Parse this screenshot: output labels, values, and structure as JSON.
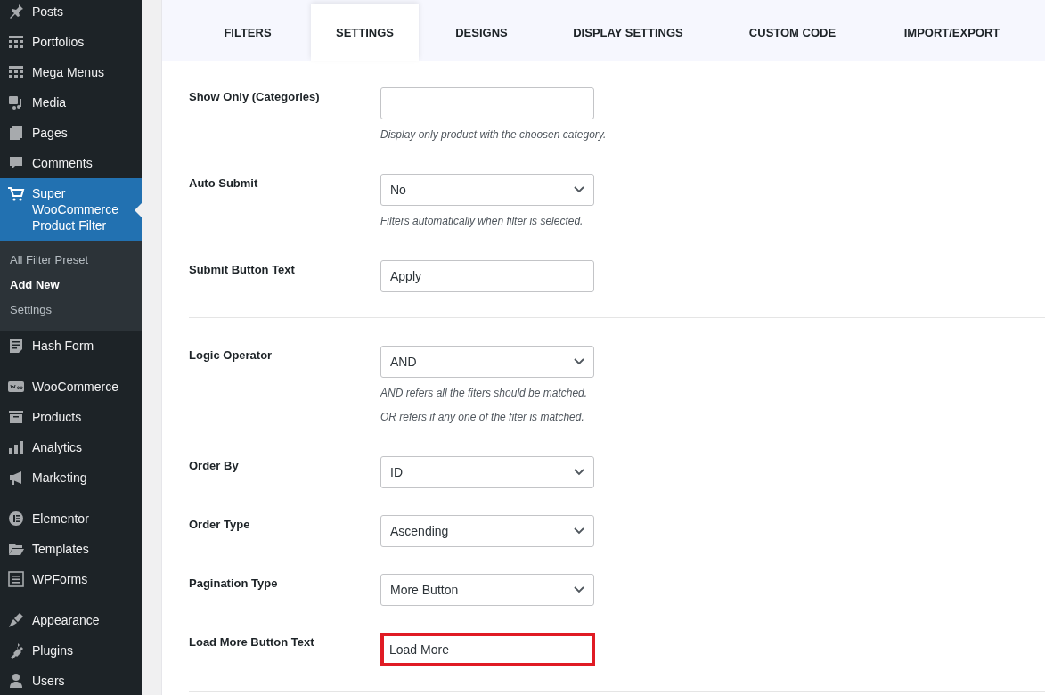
{
  "sidebar": {
    "groups": [
      {
        "items": [
          {
            "label": "Posts",
            "selected": false
          },
          {
            "label": "Portfolios",
            "selected": false
          },
          {
            "label": "Mega Menus",
            "selected": false
          },
          {
            "label": "Media",
            "selected": false
          },
          {
            "label": "Pages",
            "selected": false
          },
          {
            "label": "Comments",
            "selected": false
          },
          {
            "label": "Super WooCommerce Product Filter",
            "selected": true,
            "children": [
              {
                "label": "All Filter Preset",
                "selected": false
              },
              {
                "label": "Add New",
                "selected": true
              },
              {
                "label": "Settings",
                "selected": false
              }
            ]
          },
          {
            "label": "Hash Form",
            "selected": false
          }
        ]
      },
      {
        "items": [
          {
            "label": "WooCommerce",
            "selected": false
          },
          {
            "label": "Products",
            "selected": false
          },
          {
            "label": "Analytics",
            "selected": false
          },
          {
            "label": "Marketing",
            "selected": false
          }
        ]
      },
      {
        "items": [
          {
            "label": "Elementor",
            "selected": false
          },
          {
            "label": "Templates",
            "selected": false
          },
          {
            "label": "WPForms",
            "selected": false
          }
        ]
      },
      {
        "items": [
          {
            "label": "Appearance",
            "selected": false
          },
          {
            "label": "Plugins",
            "selected": false
          },
          {
            "label": "Users",
            "selected": false
          }
        ]
      }
    ]
  },
  "tabs": [
    {
      "label": "FILTERS",
      "selected": false
    },
    {
      "label": "SETTINGS",
      "selected": true
    },
    {
      "label": "DESIGNS",
      "selected": false
    },
    {
      "label": "DISPLAY SETTINGS",
      "selected": false
    },
    {
      "label": "CUSTOM CODE",
      "selected": false
    },
    {
      "label": "IMPORT/EXPORT",
      "selected": false
    }
  ],
  "form": {
    "sections": [
      {
        "fields": [
          {
            "label": "Show Only (Categories)",
            "kind": "text",
            "help": [
              "Display only product with the choosen category."
            ],
            "highlighted": false
          },
          {
            "label": "Auto Submit",
            "kind": "select",
            "value": "No",
            "help": [
              "Filters automatically when filter is selected."
            ],
            "highlighted": false
          },
          {
            "label": "Submit Button Text",
            "kind": "text",
            "value": "Apply",
            "highlighted": false
          }
        ]
      },
      {
        "fields": [
          {
            "label": "Logic Operator",
            "kind": "select",
            "value": "AND",
            "help": [
              "AND refers all the fiters should be matched.",
              "OR refers if any one of the fiter is matched."
            ],
            "highlighted": false
          },
          {
            "label": "Order By",
            "kind": "select",
            "value": "ID",
            "highlighted": false
          },
          {
            "label": "Order Type",
            "kind": "select",
            "value": "Ascending",
            "highlighted": false
          },
          {
            "label": "Pagination Type",
            "kind": "select",
            "value": "More Button",
            "highlighted": false
          },
          {
            "label": "Load More Button Text",
            "kind": "text",
            "value": "Load More",
            "highlighted": true
          }
        ]
      }
    ]
  }
}
